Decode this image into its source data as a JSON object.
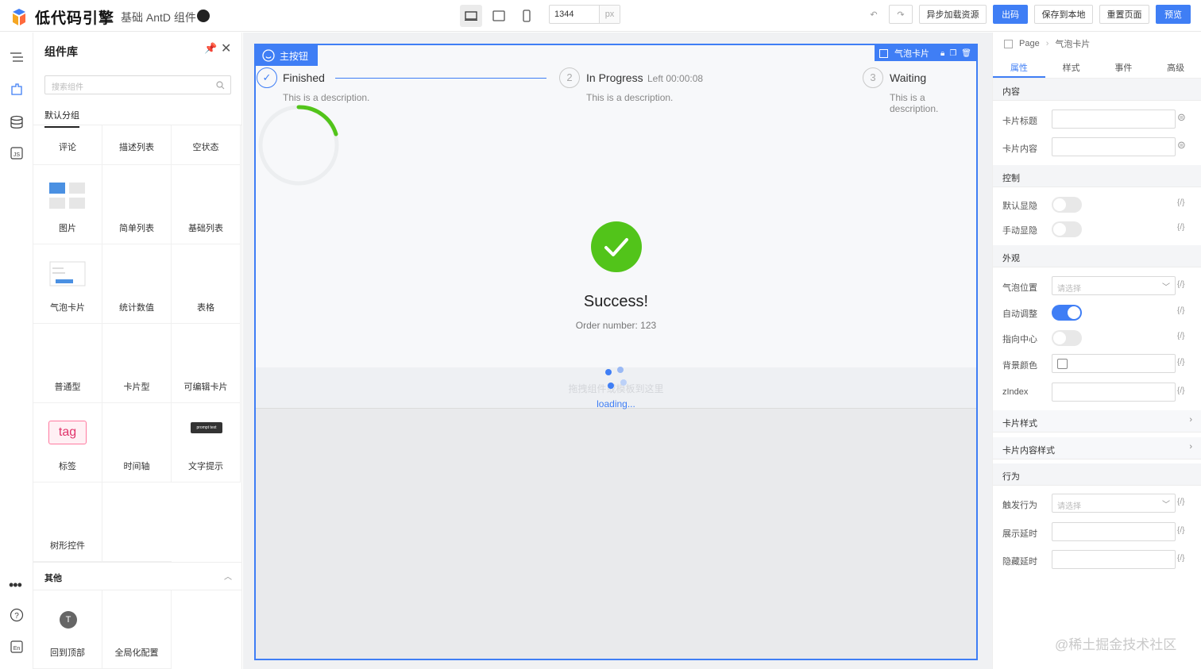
{
  "header": {
    "logo_text": "低代码引擎",
    "subtitle": "基础 AntD 组件",
    "canvas_width": "1344",
    "unit": "px",
    "buttons": {
      "async_load": "异步加载资源",
      "export": "出码",
      "save_local": "保存到本地",
      "reset": "重置页面",
      "preview": "预览"
    }
  },
  "left_panel": {
    "title": "组件库",
    "search_placeholder": "搜索组件",
    "tab_default": "默认分组",
    "components": [
      "评论",
      "描述列表",
      "空状态",
      "图片",
      "简单列表",
      "基础列表",
      "气泡卡片",
      "统计数值",
      "表格",
      "普通型",
      "卡片型",
      "可编辑卡片",
      "标签",
      "时间轴",
      "文字提示",
      "树形控件"
    ],
    "tag_thumb_text": "tag",
    "tooltip_thumb_text": "prompt text",
    "section_other": "其他",
    "other_components": [
      "回到顶部",
      "全局化配置"
    ]
  },
  "canvas": {
    "selected_label": "主按钮",
    "selected2_label": "气泡卡片",
    "steps": [
      {
        "num": "",
        "title": "Finished",
        "extra": "",
        "desc": "This is a description."
      },
      {
        "num": "2",
        "title": "In Progress",
        "extra": "Left 00:00:08",
        "desc": "This is a description."
      },
      {
        "num": "3",
        "title": "Waiting",
        "extra": "",
        "desc": "This is a description."
      }
    ],
    "success_title": "Success!",
    "success_sub": "Order number: 123",
    "drag_hint": "拖拽组件或模板到这里",
    "loading_text": "loading..."
  },
  "right_panel": {
    "crumb_root": "Page",
    "crumb_current": "气泡卡片",
    "tabs": [
      "属性",
      "样式",
      "事件",
      "高级"
    ],
    "sections": {
      "content": "内容",
      "control": "控制",
      "appearance": "外观",
      "card_style": "卡片样式",
      "card_content_style": "卡片内容样式",
      "behavior": "行为"
    },
    "fields": {
      "card_title": "卡片标题",
      "card_content": "卡片内容",
      "default_visible": "默认显隐",
      "manual_visible": "手动显隐",
      "placement": "气泡位置",
      "auto_adjust": "自动调整",
      "point_center": "指向中心",
      "bg_color": "背景颜色",
      "zindex": "zIndex",
      "trigger": "触发行为",
      "show_delay": "展示延时",
      "hide_delay": "隐藏延时"
    },
    "select_placeholder": "请选择",
    "var_icon": "{/}",
    "auto_adjust_on": true
  },
  "watermark": "@稀土掘金技术社区",
  "colors": {
    "primary": "#3f7ef5",
    "success": "#52c41a"
  }
}
